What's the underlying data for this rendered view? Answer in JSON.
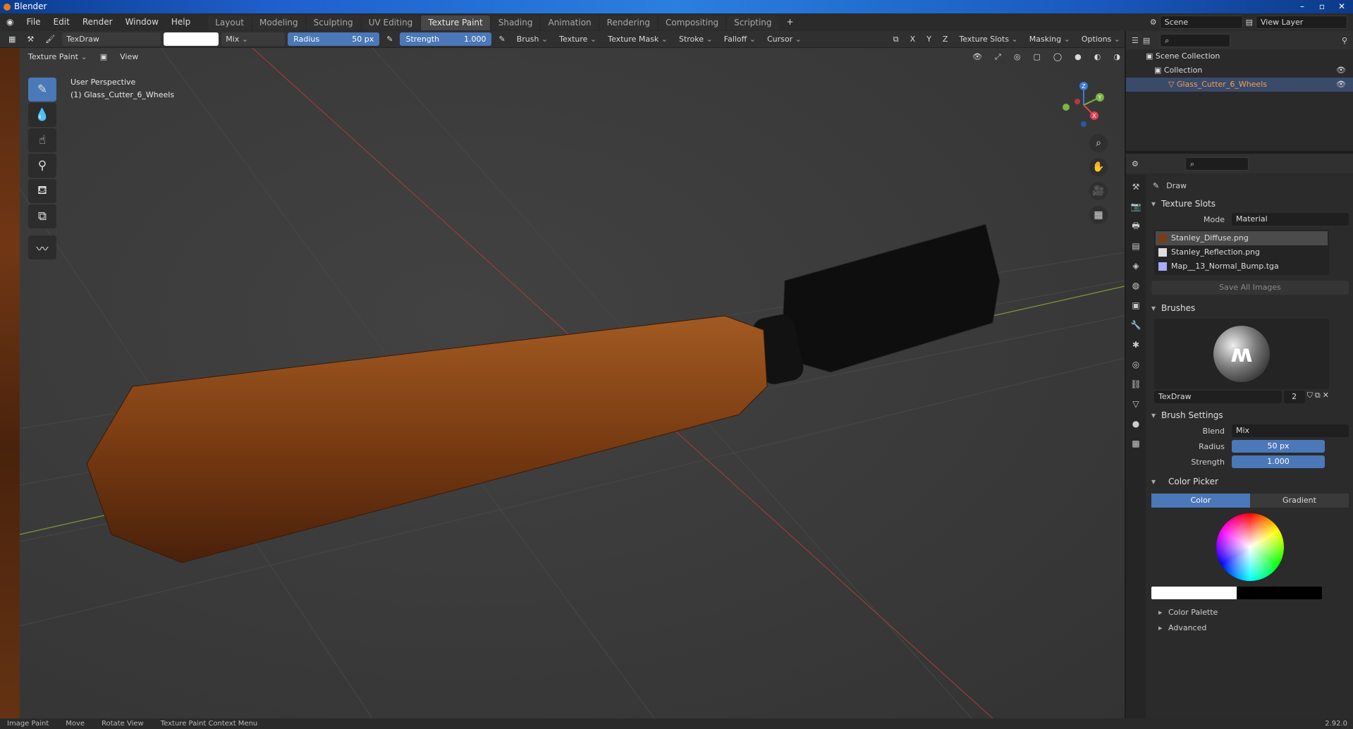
{
  "window": {
    "title": "Blender"
  },
  "menu": [
    "File",
    "Edit",
    "Render",
    "Window",
    "Help"
  ],
  "workspaces": [
    "Layout",
    "Modeling",
    "Sculpting",
    "UV Editing",
    "Texture Paint",
    "Shading",
    "Animation",
    "Rendering",
    "Compositing",
    "Scripting"
  ],
  "active_workspace": "Texture Paint",
  "scene": {
    "name": "Scene",
    "view_layer": "View Layer"
  },
  "tool_header": {
    "brush_name": "TexDraw",
    "blend": "Mix",
    "radius_label": "Radius",
    "radius_value": "50 px",
    "strength_label": "Strength",
    "strength_value": "1.000",
    "brush": "Brush",
    "texture": "Texture",
    "texture_mask": "Texture Mask",
    "stroke": "Stroke",
    "falloff": "Falloff",
    "cursor": "Cursor",
    "axes": [
      "X",
      "Y",
      "Z"
    ],
    "texture_slots": "Texture Slots",
    "masking": "Masking",
    "options": "Options"
  },
  "viewport_header": {
    "mode": "Texture Paint",
    "view": "View"
  },
  "viewport": {
    "perspective": "User Perspective",
    "object": "(1) Glass_Cutter_6_Wheels"
  },
  "outliner": {
    "root": "Scene Collection",
    "collection": "Collection",
    "object": "Glass_Cutter_6_Wheels"
  },
  "properties": {
    "tool_name": "Draw",
    "texture_slots_header": "Texture Slots",
    "mode_label": "Mode",
    "mode_value": "Material",
    "slots": [
      "Stanley_Diffuse.png",
      "Stanley_Reflection.png",
      "Map__13_Normal_Bump.tga"
    ],
    "save_all": "Save All Images",
    "brushes_header": "Brushes",
    "brush_name": "TexDraw",
    "brush_users": "2",
    "brush_settings_header": "Brush Settings",
    "blend_label": "Blend",
    "blend_value": "Mix",
    "radius_label": "Radius",
    "radius_value": "50 px",
    "strength_label": "Strength",
    "strength_value": "1.000",
    "color_picker": "Color Picker",
    "color_tab": "Color",
    "gradient_tab": "Gradient",
    "color_palette": "Color Palette",
    "advanced": "Advanced"
  },
  "statusbar": {
    "left": "Image Paint",
    "move": "Move",
    "rotate": "Rotate View",
    "context": "Texture Paint Context Menu",
    "version": "2.92.0"
  },
  "colors": {
    "accent": "#4a78b8",
    "selected_object": "#f0a050"
  }
}
